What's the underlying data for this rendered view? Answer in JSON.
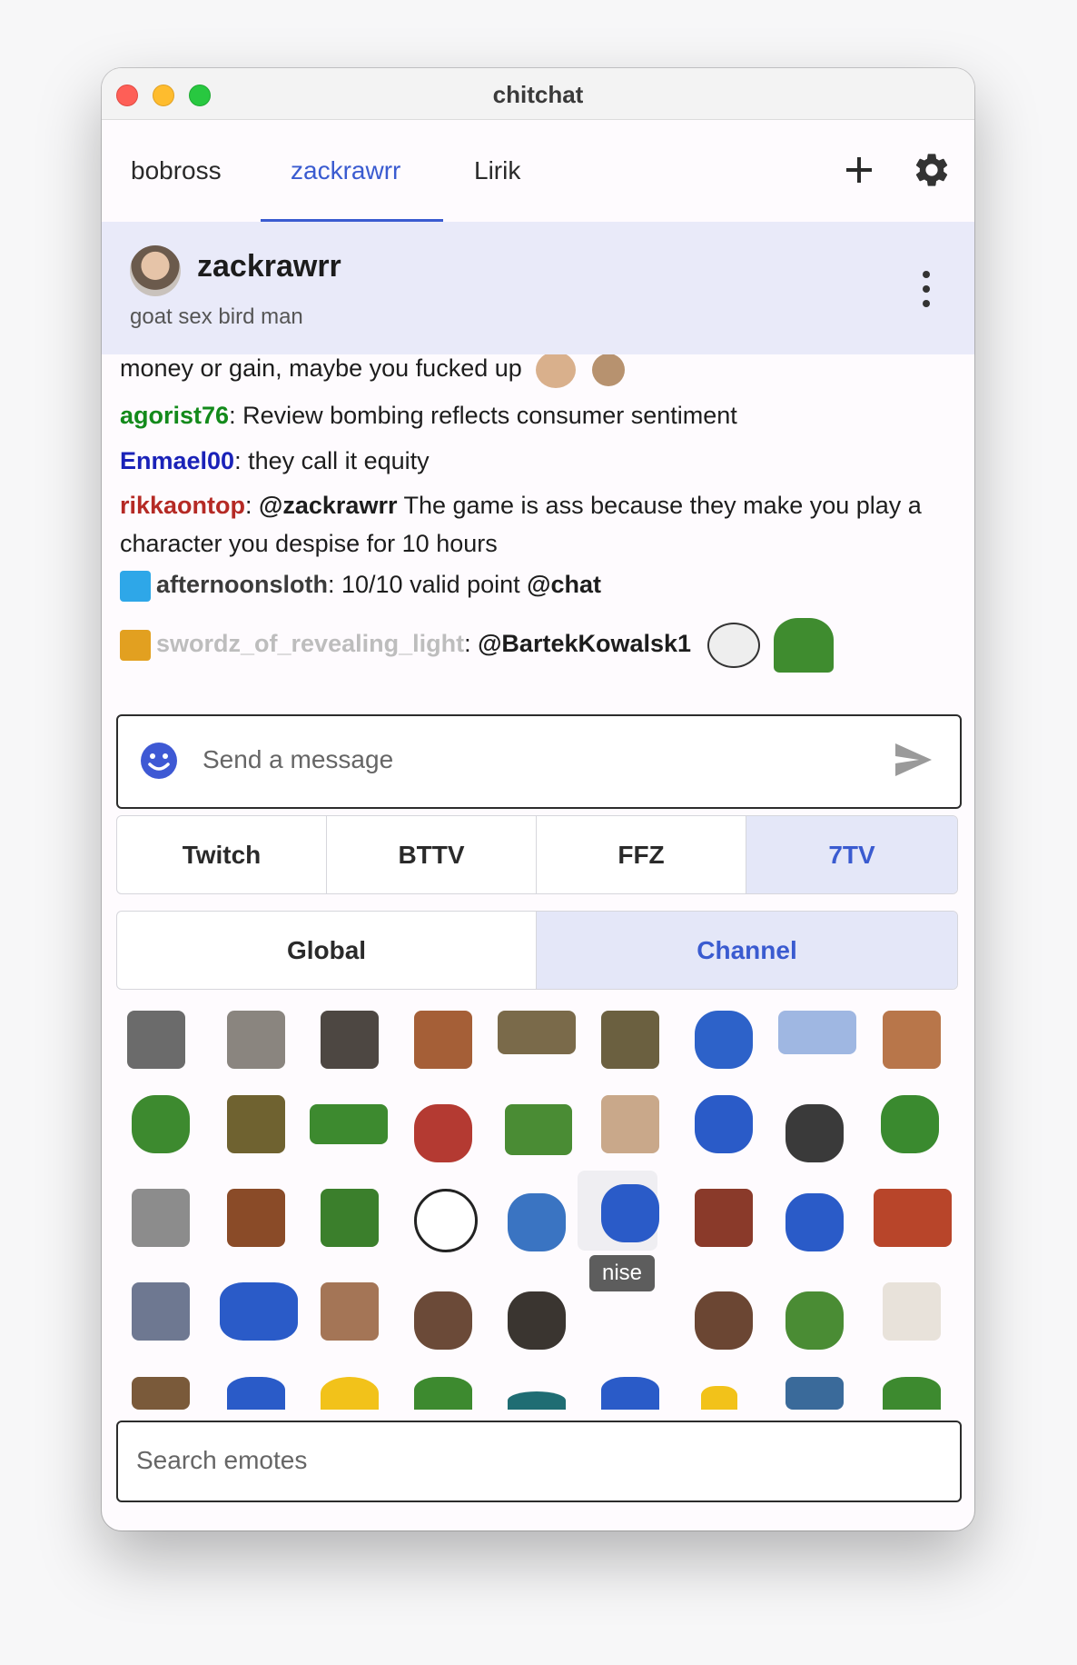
{
  "window": {
    "title": "chitchat"
  },
  "tabs": [
    {
      "label": "bobross"
    },
    {
      "label": "zackrawrr"
    },
    {
      "label": "Lirik"
    }
  ],
  "channel": {
    "name": "zackrawrr",
    "bio": "goat sex bird man"
  },
  "messages": [
    {
      "text": "money or gain, maybe you fucked up"
    },
    {
      "user": "agorist76",
      "user_color": "#138a1b",
      "text": ": Review bombing reflects consumer sentiment"
    },
    {
      "user": "Enmael00",
      "user_color": "#1a22b8",
      "text": ": they call it equity"
    },
    {
      "user": "rikkaontop",
      "user_color": "#b52a25",
      "mention": "@zackrawrr",
      "text": " The game is ass because they make you play a character you despise for 10 hours"
    },
    {
      "user": "afternoonsloth",
      "user_color": "#3b3b3b",
      "text": ": 10/10 valid point ",
      "mention": "@chat"
    },
    {
      "user": "swordz_of_revealing_light",
      "user_color": "#bdbdbd",
      "text": ": ",
      "mention": "@BartekKowalsk1"
    }
  ],
  "input": {
    "placeholder": "Send a message"
  },
  "providers": [
    {
      "label": "Twitch"
    },
    {
      "label": "BTTV"
    },
    {
      "label": "FFZ"
    },
    {
      "label": "7TV"
    }
  ],
  "scopes": [
    {
      "label": "Global"
    },
    {
      "label": "Channel"
    }
  ],
  "tooltip": {
    "text": "nise"
  },
  "emote_search": {
    "placeholder": "Search emotes"
  }
}
